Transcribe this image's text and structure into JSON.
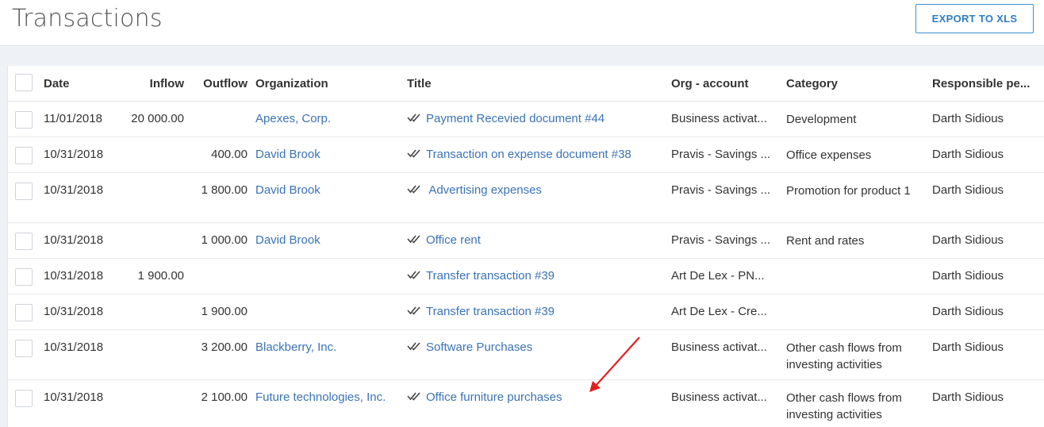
{
  "page": {
    "title": "Transactions",
    "export_label": "EXPORT TO XLS"
  },
  "table": {
    "columns": {
      "date": "Date",
      "inflow": "Inflow",
      "outflow": "Outflow",
      "organization": "Organization",
      "title": "Title",
      "org_account": "Org - account",
      "category": "Category",
      "responsible": "Responsible pe..."
    },
    "rows": [
      {
        "date": "11/01/2018",
        "inflow": "20 000.00",
        "outflow": "",
        "organization": "Apexes, Corp.",
        "title": "Payment Recevied document #44",
        "org_account": "Business activat...",
        "category": "Development",
        "responsible": "Darth Sidious"
      },
      {
        "date": "10/31/2018",
        "inflow": "",
        "outflow": "400.00",
        "organization": "David Brook",
        "title": "Transaction on expense document #38",
        "org_account": "Pravis - Savings ...",
        "category": "Office expenses",
        "responsible": "Darth Sidious"
      },
      {
        "date": "10/31/2018",
        "inflow": "",
        "outflow": "1 800.00",
        "organization": "David Brook",
        "title": " Advertising expenses",
        "org_account": "Pravis - Savings ...",
        "category": "Promotion for product 1",
        "responsible": "Darth Sidious"
      },
      {
        "date": "10/31/2018",
        "inflow": "",
        "outflow": "1 000.00",
        "organization": "David Brook",
        "title": "Office rent",
        "org_account": "Pravis - Savings ...",
        "category": "Rent and rates",
        "responsible": "Darth Sidious"
      },
      {
        "date": "10/31/2018",
        "inflow": "1 900.00",
        "outflow": "",
        "organization": "",
        "title": "Transfer transaction #39",
        "org_account": "Art De Lex - PN...",
        "category": "",
        "responsible": "Darth Sidious"
      },
      {
        "date": "10/31/2018",
        "inflow": "",
        "outflow": "1 900.00",
        "organization": "",
        "title": "Transfer transaction #39",
        "org_account": "Art De Lex - Cre...",
        "category": "",
        "responsible": "Darth Sidious"
      },
      {
        "date": "10/31/2018",
        "inflow": "",
        "outflow": "3 200.00",
        "organization": "Blackberry, Inc.",
        "title": "Software Purchases",
        "org_account": "Business activat...",
        "category": "Other cash flows from investing activities",
        "responsible": "Darth Sidious"
      },
      {
        "date": "10/31/2018",
        "inflow": "",
        "outflow": "2 100.00",
        "organization": "Future technologies, Inc.",
        "title": "Office furniture purchases",
        "org_account": "Business activat...",
        "category": "Other cash flows from investing activities",
        "responsible": "Darth Sidious"
      }
    ]
  },
  "icons": {
    "title_status": "double-check-icon",
    "annotation": "red-arrow-icon"
  },
  "colors": {
    "accent": "#2d7fc4",
    "link": "#3b73b5",
    "annotation": "#e02020"
  }
}
